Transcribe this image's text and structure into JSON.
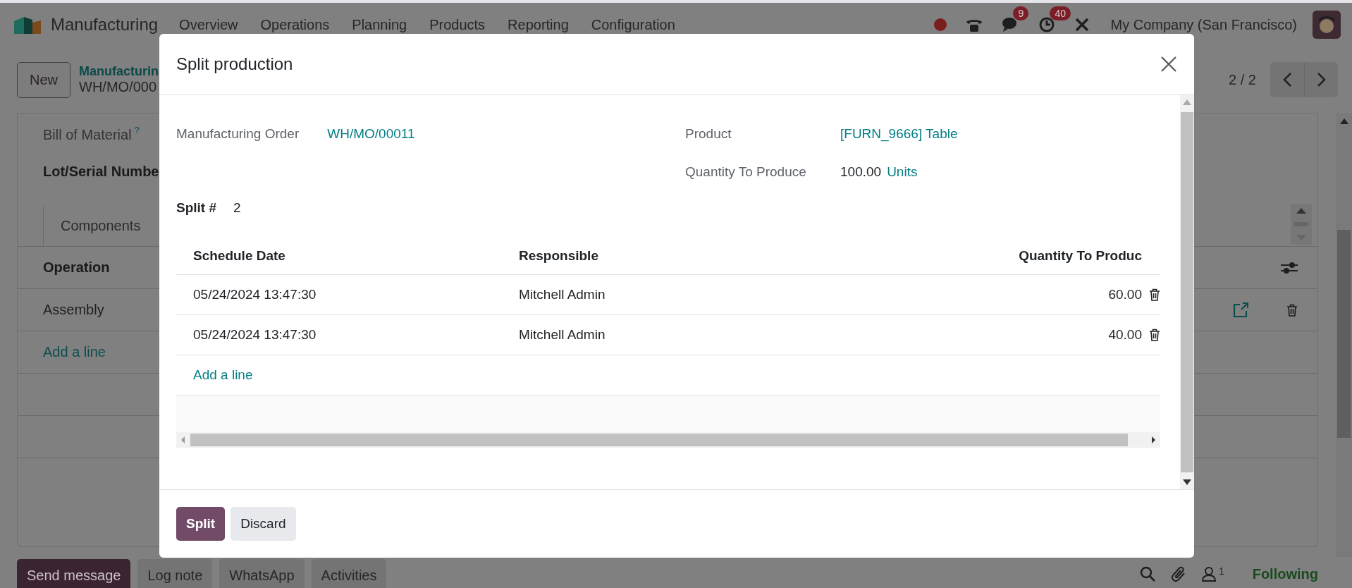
{
  "navbar": {
    "app_name": "Manufacturing",
    "menu": [
      "Overview",
      "Operations",
      "Planning",
      "Products",
      "Reporting",
      "Configuration"
    ],
    "message_badge": "9",
    "activity_badge": "40",
    "company": "My Company (San Francisco)"
  },
  "control_panel": {
    "new_button": "New",
    "breadcrumb": "Manufacturin",
    "record": "WH/MO/000",
    "pager": "2 / 2"
  },
  "form": {
    "bill_of_material": {
      "label": "Bill of Material",
      "help": "?"
    },
    "lot_serial": {
      "label": "Lot/Serial Numbe"
    },
    "tab": "Components",
    "operations": {
      "column": "Operation",
      "rows": [
        "Assembly"
      ],
      "add_line": "Add a line"
    }
  },
  "dialog": {
    "title": "Split production",
    "manufacturing_order": {
      "label": "Manufacturing Order",
      "value": "WH/MO/00011"
    },
    "product": {
      "label": "Product",
      "value": "[FURN_9666] Table"
    },
    "quantity": {
      "label": "Quantity To Produce",
      "value": "100.00",
      "unit": "Units"
    },
    "split_count": {
      "label": "Split #",
      "value": "2"
    },
    "table": {
      "columns": [
        "Schedule Date",
        "Responsible",
        "Quantity To Produc"
      ],
      "rows": [
        {
          "date": "05/24/2024 13:47:30",
          "responsible": "Mitchell Admin",
          "quantity": "60.00"
        },
        {
          "date": "05/24/2024 13:47:30",
          "responsible": "Mitchell Admin",
          "quantity": "40.00"
        }
      ],
      "add_line": "Add a line"
    },
    "buttons": [
      {
        "label": "Split",
        "kind": "primary"
      },
      {
        "label": "Discard",
        "kind": "secondary"
      }
    ]
  },
  "chatter": {
    "buttons": [
      {
        "label": "Send message",
        "kind": "primary"
      },
      {
        "label": "Log note",
        "kind": "secondary"
      },
      {
        "label": "WhatsApp",
        "kind": "secondary"
      },
      {
        "label": "Activities",
        "kind": "secondary"
      }
    ],
    "followers_count": "1",
    "follow_status": "Following"
  }
}
